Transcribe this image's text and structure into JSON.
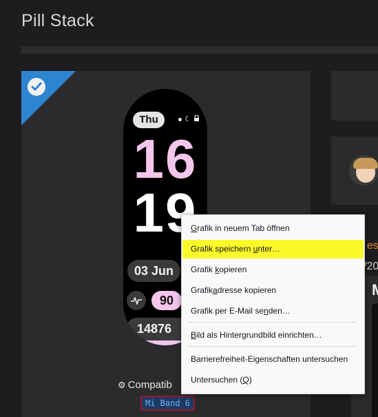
{
  "page": {
    "title": "Pill Stack"
  },
  "watch": {
    "day": "Thu",
    "hour": "16",
    "minute": "19",
    "date": "03 Jun",
    "heart_rate": "90",
    "steps": "14876"
  },
  "compat": {
    "label": "Compatib",
    "device": "Mi Band 6"
  },
  "side": {
    "text1": "esc",
    "text2": "/20",
    "letter": "M"
  },
  "context_menu": {
    "items": [
      {
        "label": "Grafik in neuem Tab öffnen",
        "pre": "",
        "key": "G",
        "post": "rafik in neuem Tab öffnen"
      },
      {
        "label": "Grafik speichern unter…",
        "pre": "Grafik speichern ",
        "key": "u",
        "post": "nter…"
      },
      {
        "label": "Grafik kopieren",
        "pre": "Grafik ",
        "key": "k",
        "post": "opieren"
      },
      {
        "label": "Grafikadresse kopieren",
        "pre": "Grafik",
        "key": "a",
        "post": "dresse kopieren"
      },
      {
        "label": "Grafik per E-Mail senden…",
        "pre": "Grafik per E-Mail se",
        "key": "n",
        "post": "den…"
      },
      {
        "label": "Bild als Hintergrundbild einrichten…",
        "pre": "",
        "key": "B",
        "post": "ild als Hintergrundbild einrichten…"
      },
      {
        "label": "Barrierefreiheit-Eigenschaften untersuchen",
        "pre": "Barrierefreiheit-Eigenschaften untersuchen",
        "key": "",
        "post": ""
      },
      {
        "label": "Untersuchen (Q)",
        "pre": "Untersuchen (",
        "key": "Q",
        "post": ")"
      }
    ]
  },
  "colors": {
    "background": "#1d1d1f",
    "ribbon": "#2e86d1",
    "accent_pink": "#f4c6ec",
    "highlight": "#fbf92a",
    "device_tag_border": "#a0142c"
  }
}
